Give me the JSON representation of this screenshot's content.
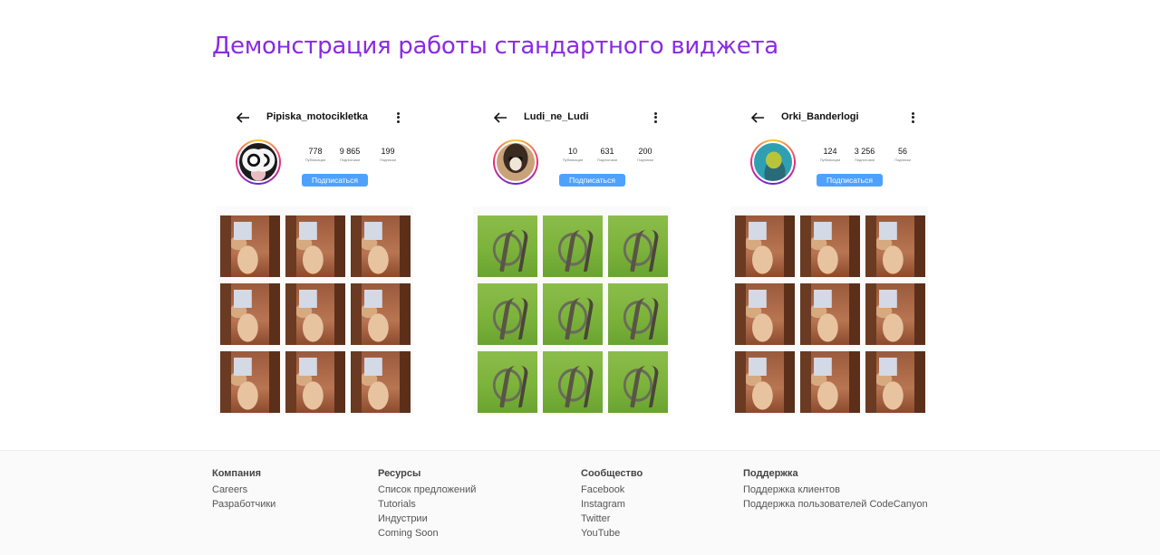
{
  "title": "Демонстрация работы стандартного виджета",
  "widgets": [
    {
      "username": "Pipiska_motocikletka",
      "avatar": "avatar-powerpuff",
      "stats": [
        {
          "value": "778",
          "label": "Публикации"
        },
        {
          "value": "9 865",
          "label": "Подписчики"
        },
        {
          "value": "199",
          "label": "Подписки"
        }
      ],
      "follow_label": "Подписаться",
      "tile_image": "room-photo"
    },
    {
      "username": "Ludi_ne_Ludi",
      "avatar": "avatar-ferret",
      "stats": [
        {
          "value": "10",
          "label": "Публикации"
        },
        {
          "value": "631",
          "label": "Подписчики"
        },
        {
          "value": "200",
          "label": "Подписки"
        }
      ],
      "follow_label": "Подписаться",
      "tile_image": "snake-photo"
    },
    {
      "username": "Orki_Banderlogi",
      "avatar": "avatar-cartoon",
      "stats": [
        {
          "value": "124",
          "label": "Публикации"
        },
        {
          "value": "3 256",
          "label": "Подписчики"
        },
        {
          "value": "56",
          "label": "Подписки"
        }
      ],
      "follow_label": "Подписаться",
      "tile_image": "room-photo"
    }
  ],
  "footer": {
    "columns": [
      {
        "title": "Компания",
        "links": [
          "Careers",
          "Разработчики"
        ]
      },
      {
        "title": "Ресурсы",
        "links": [
          "Список предложений",
          "Tutorials",
          "Индустрии",
          "Coming Soon"
        ]
      },
      {
        "title": "Сообщество",
        "links": [
          "Facebook",
          "Instagram",
          "Twitter",
          "YouTube"
        ]
      },
      {
        "title": "Поддержка",
        "links": [
          "Поддержка клиентов",
          "Поддержка пользователей CodeCanyon"
        ]
      }
    ]
  },
  "colors": {
    "title": "#8a2be2",
    "follow_button": "#4ea1ff"
  }
}
